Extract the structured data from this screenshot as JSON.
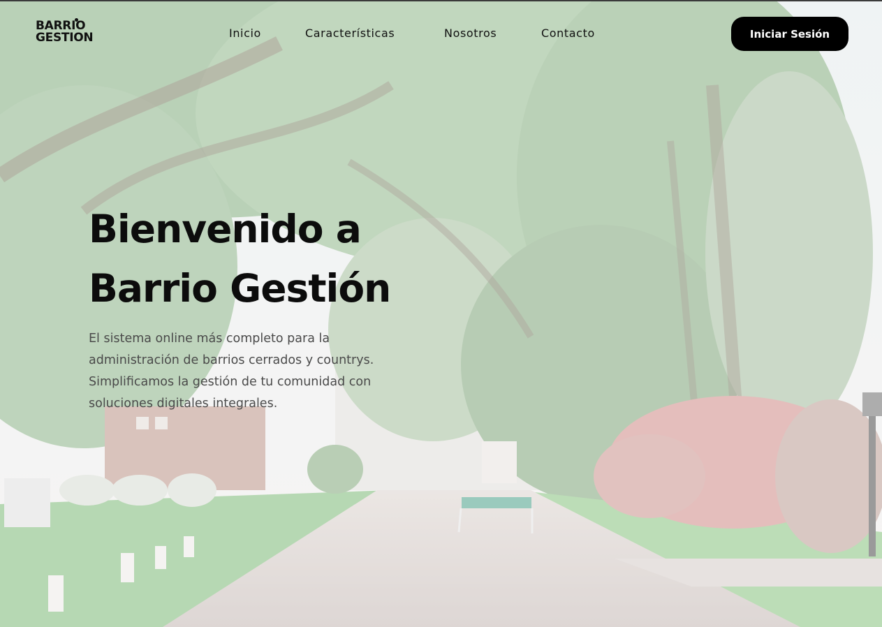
{
  "brand": {
    "logo_line1": "BARRIO",
    "logo_line2": "GESTION"
  },
  "nav": {
    "items": [
      {
        "label": "Inicio"
      },
      {
        "label": "Características"
      },
      {
        "label": "Nosotros"
      },
      {
        "label": "Contacto"
      }
    ]
  },
  "header": {
    "login_label": "Iniciar Sesión"
  },
  "hero": {
    "title_line1": "Bienvenido a",
    "title_line2": "Barrio Gestión",
    "description_lines": [
      "El sistema online más completo para la",
      "administración de barrios cerrados y countrys.",
      "Simplificamos la gestión de tu comunidad con",
      "soluciones digitales integrales."
    ]
  },
  "colors": {
    "button_bg": "#000000",
    "button_text": "#ffffff",
    "title_text": "#0c0c0c",
    "body_text": "#4a4a4a"
  }
}
